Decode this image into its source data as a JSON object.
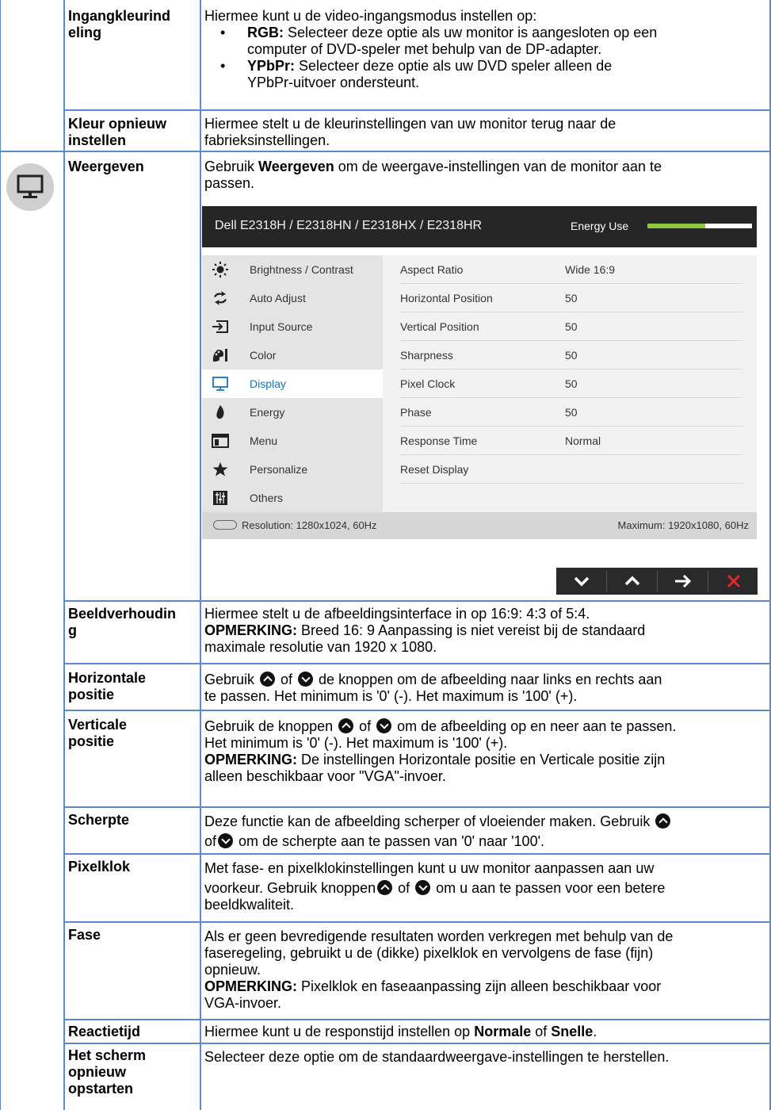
{
  "rows": {
    "ingang": {
      "label": "Ingangkleurindeling",
      "label_l1": "Ingangkleurind",
      "label_l2": "eling",
      "intro": "Hiermee kunt u de video-ingangsmodus instellen op:",
      "bullets": [
        {
          "term": "RGB:",
          "text_l1": " Selecteer deze optie als uw monitor is aangesloten op een",
          "text_l2": "computer of DVD-speler met behulp van de DP-adapter."
        },
        {
          "term": "YPbPr:",
          "text_l1": " Selecteer deze optie als uw DVD speler alleen de",
          "text_l2": "YPbPr-uitvoer ondersteunt."
        }
      ]
    },
    "kleur_reset": {
      "label_l1": "Kleur opnieuw",
      "label_l2": "instellen",
      "desc_l1": "Hiermee stelt u de kleurinstellingen van uw monitor terug naar de",
      "desc_l2": "fabrieksinstellingen."
    },
    "weergeven": {
      "label": "Weergeven",
      "desc_pre": "Gebruik ",
      "desc_bold": "Weergeven",
      "desc_post": " om de weergave-instellingen van de monitor aan te",
      "desc_l2": "passen."
    },
    "beeld": {
      "label_l1": "Beeldverhoudin",
      "label_l2": "g",
      "desc_l1": "Hiermee stelt u de afbeeldingsinterface in op 16:9: 4:3 of 5:4.",
      "note_label": "OPMERKING:",
      "note_l1": " Breed 16: 9 Aanpassing is niet vereist bij de standaard",
      "note_l2": "maximale resolutie van 1920 x 1080."
    },
    "hpos": {
      "label_l1": "Horizontale",
      "label_l2": "positie",
      "t1": "Gebruik ",
      "t2": " of ",
      "t3": " de knoppen om de afbeelding naar links en rechts aan",
      "l2": "te passen. Het minimum is '0' (-). Het maximum is '100' (+)."
    },
    "vpos": {
      "label_l1": "Verticale",
      "label_l2": "positie",
      "t1": "Gebruik de knoppen ",
      "t2": " of ",
      "t3": " om de afbeelding op en neer aan te passen.",
      "l2": "Het minimum is '0' (-). Het maximum is '100' (+).",
      "note_label": "OPMERKING:",
      "note_l1": " De instellingen Horizontale positie en Verticale positie zijn",
      "note_l2": "alleen beschikbaar voor \"VGA\"-invoer."
    },
    "scherpte": {
      "label": "Scherpte",
      "l1": "Deze functie kan de afbeelding scherper of vloeiender maken. Gebruik ",
      "l2a": "of",
      "l2b": " om de scherpte aan te passen van '0' naar '100'."
    },
    "pixelklok": {
      "label": "Pixelklok",
      "l1": "Met fase- en pixelklokinstellingen kunt u uw monitor aanpassen aan uw",
      "l2a": "voorkeur. Gebruik knoppen",
      "l2b": " of ",
      "l2c": " om u aan te passen voor een betere",
      "l3": "beeldkwaliteit."
    },
    "fase": {
      "label": "Fase",
      "l1": "Als er geen bevredigende resultaten worden verkregen met behulp van de",
      "l2": "faseregeling, gebruikt u de (dikke) pixelklok en vervolgens de fase (fijn)",
      "l3": "opnieuw.",
      "note_label": "OPMERKING:",
      "note_l1": " Pixelklok en faseaanpassing zijn alleen beschikbaar voor",
      "note_l2": "VGA-invoer."
    },
    "reactie": {
      "label": "Reactietijd",
      "t1": "Hiermee kunt u de responstijd instellen op ",
      "b1": "Normale",
      "t2": " of ",
      "b2": "Snelle",
      "t3": "."
    },
    "reset": {
      "label_l1": "Het scherm",
      "label_l2": "opnieuw",
      "label_l3": "opstarten",
      "desc": "Selecteer deze optie om de standaardweergave-instellingen te herstellen."
    }
  },
  "osd": {
    "title": "Dell E2318H / E2318HN / E2318HX / E2318HR",
    "energy_label": "Energy Use",
    "energy_level": 0.55,
    "menu": [
      {
        "label": "Brightness / Contrast",
        "icon": "brightness-icon"
      },
      {
        "label": "Auto Adjust",
        "icon": "auto-adjust-icon"
      },
      {
        "label": "Input Source",
        "icon": "input-source-icon"
      },
      {
        "label": "Color",
        "icon": "color-icon"
      },
      {
        "label": "Display",
        "icon": "display-icon",
        "active": true
      },
      {
        "label": "Energy",
        "icon": "energy-icon"
      },
      {
        "label": "Menu",
        "icon": "menu-icon"
      },
      {
        "label": "Personalize",
        "icon": "star-icon"
      },
      {
        "label": "Others",
        "icon": "others-icon"
      }
    ],
    "settings": [
      {
        "key": "Aspect Ratio",
        "value": "Wide 16:9"
      },
      {
        "key": "Horizontal Position",
        "value": "50"
      },
      {
        "key": "Vertical Position",
        "value": "50"
      },
      {
        "key": "Sharpness",
        "value": "50"
      },
      {
        "key": "Pixel Clock",
        "value": "50"
      },
      {
        "key": "Phase",
        "value": "50"
      },
      {
        "key": "Response Time",
        "value": "Normal"
      },
      {
        "key": "Reset Display",
        "value": ""
      }
    ],
    "resolution": "Resolution: 1280x1024, 60Hz",
    "maximum": "Maximum: 1920x1080, 60Hz",
    "nav_buttons": [
      "down-icon",
      "up-icon",
      "right-arrow-icon",
      "close-icon"
    ],
    "accent": "#1b73b9",
    "energy_color": "#8cc63f"
  }
}
